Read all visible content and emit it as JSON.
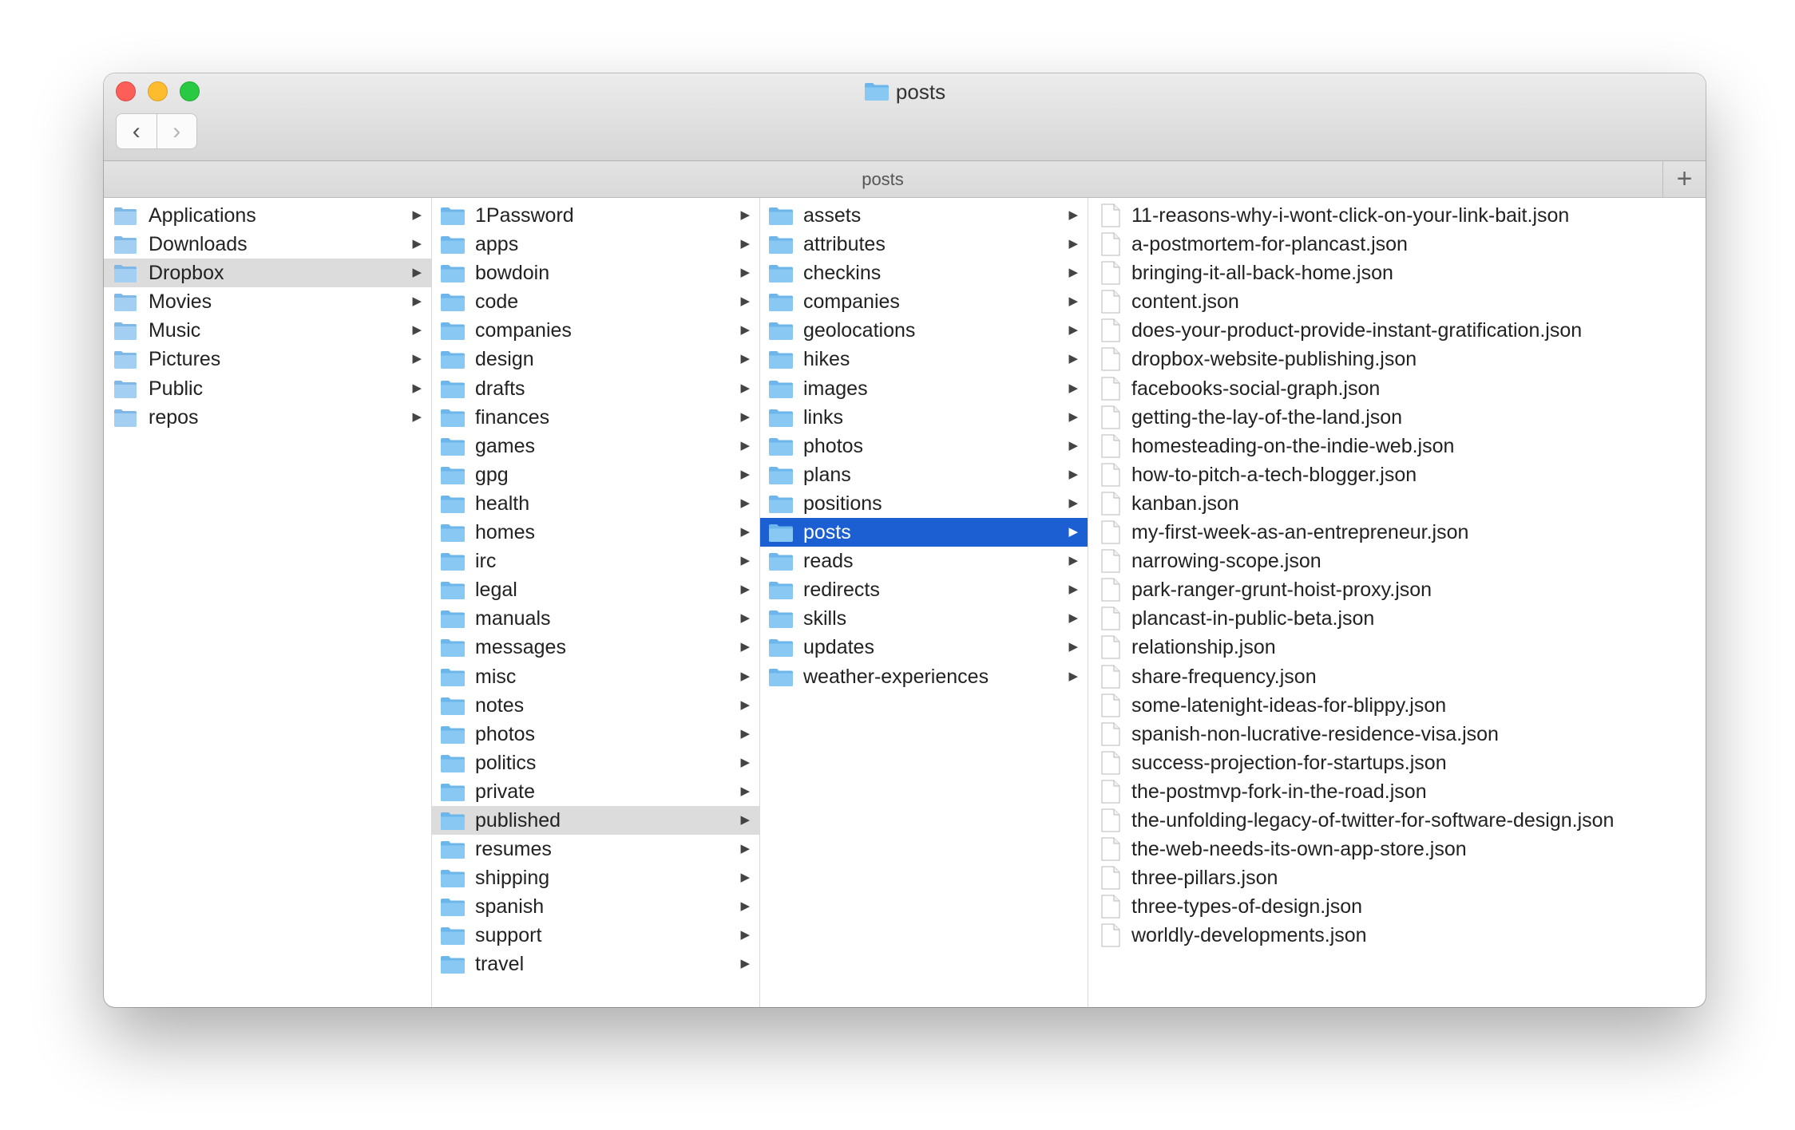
{
  "window": {
    "title": "posts"
  },
  "toolbar": {
    "back_glyph": "‹",
    "forward_glyph": "›"
  },
  "pathbar": {
    "label": "posts",
    "add_tab_glyph": "+"
  },
  "icons": {
    "folder": "folder-icon",
    "file": "document-icon",
    "disclosure": "disclosure-arrow-icon"
  },
  "colors": {
    "selection_active": "#1c5fd2",
    "selection_inactive": "#dcdcdc",
    "folder_blue": "#7cc0ee"
  },
  "columns": [
    {
      "items": [
        {
          "label": "Applications",
          "icon": "applications-folder-icon",
          "selected": ""
        },
        {
          "label": "Downloads",
          "icon": "downloads-folder-icon",
          "selected": ""
        },
        {
          "label": "Dropbox",
          "icon": "dropbox-folder-icon",
          "selected": "inactive"
        },
        {
          "label": "Movies",
          "icon": "movies-folder-icon",
          "selected": ""
        },
        {
          "label": "Music",
          "icon": "music-folder-icon",
          "selected": ""
        },
        {
          "label": "Pictures",
          "icon": "pictures-folder-icon",
          "selected": ""
        },
        {
          "label": "Public",
          "icon": "public-folder-icon",
          "selected": ""
        },
        {
          "label": "repos",
          "icon": "folder-icon",
          "selected": ""
        }
      ]
    },
    {
      "items": [
        {
          "label": "1Password",
          "selected": ""
        },
        {
          "label": "apps",
          "selected": ""
        },
        {
          "label": "bowdoin",
          "selected": ""
        },
        {
          "label": "code",
          "selected": ""
        },
        {
          "label": "companies",
          "selected": ""
        },
        {
          "label": "design",
          "selected": ""
        },
        {
          "label": "drafts",
          "selected": ""
        },
        {
          "label": "finances",
          "selected": ""
        },
        {
          "label": "games",
          "selected": ""
        },
        {
          "label": "gpg",
          "selected": ""
        },
        {
          "label": "health",
          "selected": ""
        },
        {
          "label": "homes",
          "selected": ""
        },
        {
          "label": "irc",
          "selected": ""
        },
        {
          "label": "legal",
          "selected": ""
        },
        {
          "label": "manuals",
          "selected": ""
        },
        {
          "label": "messages",
          "selected": ""
        },
        {
          "label": "misc",
          "selected": ""
        },
        {
          "label": "notes",
          "selected": ""
        },
        {
          "label": "photos",
          "selected": ""
        },
        {
          "label": "politics",
          "selected": ""
        },
        {
          "label": "private",
          "selected": ""
        },
        {
          "label": "published",
          "selected": "inactive"
        },
        {
          "label": "resumes",
          "selected": ""
        },
        {
          "label": "shipping",
          "selected": ""
        },
        {
          "label": "spanish",
          "selected": ""
        },
        {
          "label": "support",
          "selected": ""
        },
        {
          "label": "travel",
          "selected": ""
        }
      ]
    },
    {
      "items": [
        {
          "label": "assets",
          "selected": ""
        },
        {
          "label": "attributes",
          "selected": ""
        },
        {
          "label": "checkins",
          "selected": ""
        },
        {
          "label": "companies",
          "selected": ""
        },
        {
          "label": "geolocations",
          "selected": ""
        },
        {
          "label": "hikes",
          "selected": ""
        },
        {
          "label": "images",
          "selected": ""
        },
        {
          "label": "links",
          "selected": ""
        },
        {
          "label": "photos",
          "selected": ""
        },
        {
          "label": "plans",
          "selected": ""
        },
        {
          "label": "positions",
          "selected": ""
        },
        {
          "label": "posts",
          "selected": "active"
        },
        {
          "label": "reads",
          "selected": ""
        },
        {
          "label": "redirects",
          "selected": ""
        },
        {
          "label": "skills",
          "selected": ""
        },
        {
          "label": "updates",
          "selected": ""
        },
        {
          "label": "weather-experiences",
          "selected": ""
        }
      ]
    },
    {
      "items": [
        {
          "label": "11-reasons-why-i-wont-click-on-your-link-bait.json"
        },
        {
          "label": "a-postmortem-for-plancast.json"
        },
        {
          "label": "bringing-it-all-back-home.json"
        },
        {
          "label": "content.json"
        },
        {
          "label": "does-your-product-provide-instant-gratification.json"
        },
        {
          "label": "dropbox-website-publishing.json"
        },
        {
          "label": "facebooks-social-graph.json"
        },
        {
          "label": "getting-the-lay-of-the-land.json"
        },
        {
          "label": "homesteading-on-the-indie-web.json"
        },
        {
          "label": "how-to-pitch-a-tech-blogger.json"
        },
        {
          "label": "kanban.json"
        },
        {
          "label": "my-first-week-as-an-entrepreneur.json"
        },
        {
          "label": "narrowing-scope.json"
        },
        {
          "label": "park-ranger-grunt-hoist-proxy.json"
        },
        {
          "label": "plancast-in-public-beta.json"
        },
        {
          "label": "relationship.json"
        },
        {
          "label": "share-frequency.json"
        },
        {
          "label": "some-latenight-ideas-for-blippy.json"
        },
        {
          "label": "spanish-non-lucrative-residence-visa.json"
        },
        {
          "label": "success-projection-for-startups.json"
        },
        {
          "label": "the-postmvp-fork-in-the-road.json"
        },
        {
          "label": "the-unfolding-legacy-of-twitter-for-software-design.json"
        },
        {
          "label": "the-web-needs-its-own-app-store.json"
        },
        {
          "label": "three-pillars.json"
        },
        {
          "label": "three-types-of-design.json"
        },
        {
          "label": "worldly-developments.json"
        }
      ]
    }
  ]
}
